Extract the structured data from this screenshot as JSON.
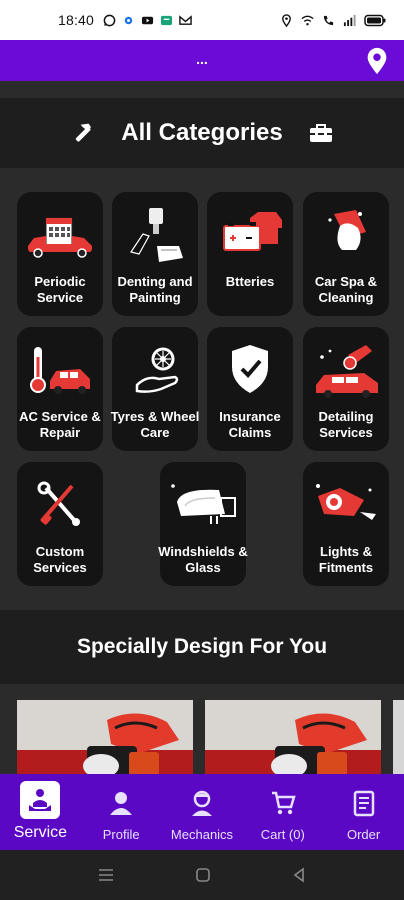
{
  "status_bar": {
    "time": "18:40",
    "left_icons": [
      "whatsapp-icon",
      "settings-icon",
      "youtube-icon",
      "message-icon",
      "gmail-icon"
    ],
    "right_icons": [
      "location-icon",
      "wifi-icon",
      "call-icon",
      "signal-icon",
      "battery-icon"
    ]
  },
  "top_bar": {
    "title": "...",
    "accent": "#6a0bd6"
  },
  "categories": {
    "title": "All Categories",
    "items": [
      {
        "label": "Periodic Service",
        "icon": "car-calendar-icon"
      },
      {
        "label": "Denting and Painting",
        "icon": "spray-paint-icon"
      },
      {
        "label": "Btteries",
        "icon": "battery-icon"
      },
      {
        "label": "Car Spa & Cleaning",
        "icon": "car-wash-icon"
      },
      {
        "label": "AC Service & Repair",
        "icon": "ac-thermometer-icon"
      },
      {
        "label": "Tyres & Wheel Care",
        "icon": "tyre-hand-icon"
      },
      {
        "label": "Insurance Claims",
        "icon": "shield-check-icon"
      },
      {
        "label": "Detailing Services",
        "icon": "car-polish-icon"
      },
      {
        "label": "Custom Services",
        "icon": "tools-icon"
      },
      {
        "label": "Windshields & Glass",
        "icon": "windshield-icon"
      },
      {
        "label": "Lights & Fitments",
        "icon": "headlight-icon"
      }
    ]
  },
  "special": {
    "title": "Specially Design For You"
  },
  "bottom_nav": {
    "items": [
      {
        "label": "Service",
        "icon": "service-icon",
        "active": true
      },
      {
        "label": "Profile",
        "icon": "profile-icon",
        "active": false
      },
      {
        "label": "Mechanics",
        "icon": "mechanic-icon",
        "active": false
      },
      {
        "label": "Cart (0)",
        "icon": "cart-icon",
        "active": false
      },
      {
        "label": "Order",
        "icon": "order-icon",
        "active": false
      }
    ]
  }
}
